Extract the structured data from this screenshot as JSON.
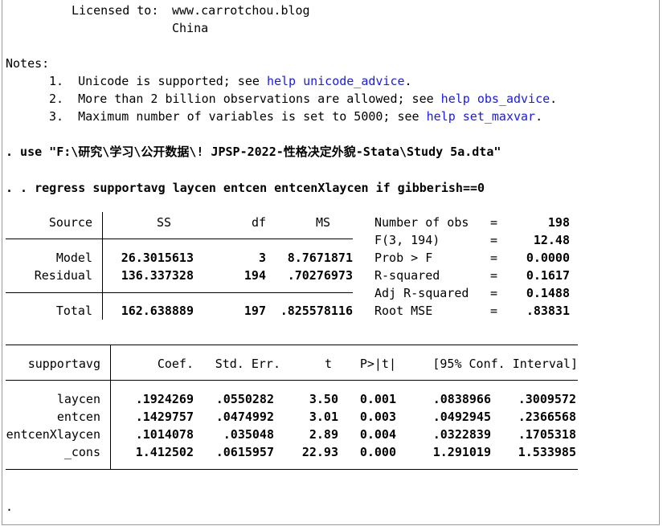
{
  "license": {
    "label": "Licensed to:",
    "site": "www.carrotchou.blog",
    "country": "China"
  },
  "notes": {
    "heading": "Notes:",
    "items": [
      {
        "num": "1.",
        "text": "Unicode is supported; see",
        "link": "help unicode_advice",
        "tail": "."
      },
      {
        "num": "2.",
        "text": "More than 2 billion observations are allowed; see",
        "link": "help obs_advice",
        "tail": "."
      },
      {
        "num": "3.",
        "text": "Maximum number of variables is set to 5000; see",
        "link": "help set_maxvar",
        "tail": "."
      }
    ]
  },
  "commands": {
    "use_cmd": ". use \"F:\\研究\\学习\\公开数据\\! JPSP-2022-性格决定外貌-Stata\\Study 5a.dta\"",
    "regress_cmd": ". . regress supportavg laycen entcen entcenXlaycen if gibberish==0"
  },
  "anova": {
    "headers": {
      "source": "Source",
      "ss": "SS",
      "df": "df",
      "ms": "MS"
    },
    "rows": [
      {
        "source": "Model",
        "ss": "26.3015613",
        "df": "3",
        "ms": "8.7671871"
      },
      {
        "source": "Residual",
        "ss": "136.337328",
        "df": "194",
        "ms": ".70276973"
      }
    ],
    "total": {
      "source": "Total",
      "ss": "162.638889",
      "df": "197",
      "ms": ".825578116"
    }
  },
  "stats": [
    {
      "label": "Number of obs",
      "eq": "=",
      "value": "198"
    },
    {
      "label": "F(3, 194)",
      "eq": "=",
      "value": "12.48"
    },
    {
      "label": "Prob > F",
      "eq": "=",
      "value": "0.0000"
    },
    {
      "label": "R-squared",
      "eq": "=",
      "value": "0.1617"
    },
    {
      "label": "Adj R-squared",
      "eq": "=",
      "value": "0.1488"
    },
    {
      "label": "Root MSE",
      "eq": "=",
      "value": ".83831"
    }
  ],
  "coef_table": {
    "headers": {
      "var": "supportavg",
      "coef": "Coef.",
      "se": "Std. Err.",
      "t": "t",
      "p": "P>|t|",
      "ci": "[95% Conf. Interval]"
    },
    "rows": [
      {
        "var": "laycen",
        "coef": ".1924269",
        "se": ".0550282",
        "t": "3.50",
        "p": "0.001",
        "lo": ".0838966",
        "hi": ".3009572"
      },
      {
        "var": "entcen",
        "coef": ".1429757",
        "se": ".0474992",
        "t": "3.01",
        "p": "0.003",
        "lo": ".0492945",
        "hi": ".2366568"
      },
      {
        "var": "entcenXlaycen",
        "coef": ".1014078",
        "se": ".035048",
        "t": "2.89",
        "p": "0.004",
        "lo": ".0322839",
        "hi": ".1705318"
      },
      {
        "var": "_cons",
        "coef": "1.412502",
        "se": ".0615957",
        "t": "22.93",
        "p": "0.000",
        "lo": "1.291019",
        "hi": "1.533985"
      }
    ]
  },
  "prompt": "."
}
